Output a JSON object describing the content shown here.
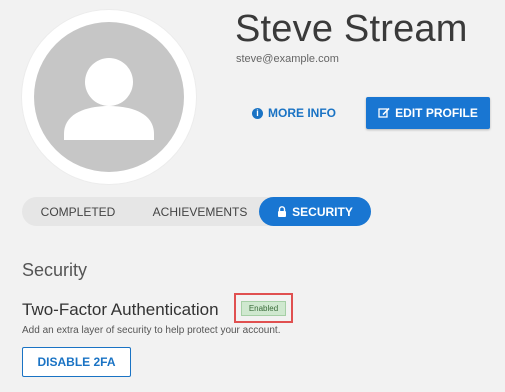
{
  "profile": {
    "name": "Steve Stream",
    "email": "steve@example.com",
    "avatar_icon": "person-icon"
  },
  "actions": {
    "more_info_label": "MORE INFO",
    "more_info_icon": "info-icon",
    "more_info_icon_glyph": "i",
    "edit_profile_label": "EDIT PROFILE",
    "edit_profile_icon": "edit-icon"
  },
  "tabs": [
    {
      "label": "COMPLETED",
      "active": false
    },
    {
      "label": "ACHIEVEMENTS",
      "active": false
    },
    {
      "label": "SECURITY",
      "active": true,
      "icon": "lock-icon"
    }
  ],
  "security": {
    "heading": "Security",
    "two_factor": {
      "title": "Two-Factor Authentication",
      "status": "Enabled",
      "description": "Add an extra layer of security to help protect your account.",
      "disable_label": "DISABLE 2FA"
    }
  },
  "colors": {
    "accent": "#1976d2",
    "background": "#f2f2f2",
    "avatar_bg": "#c6c6c6",
    "badge_bg": "#cfe8cf",
    "highlight_border": "#e05050"
  }
}
